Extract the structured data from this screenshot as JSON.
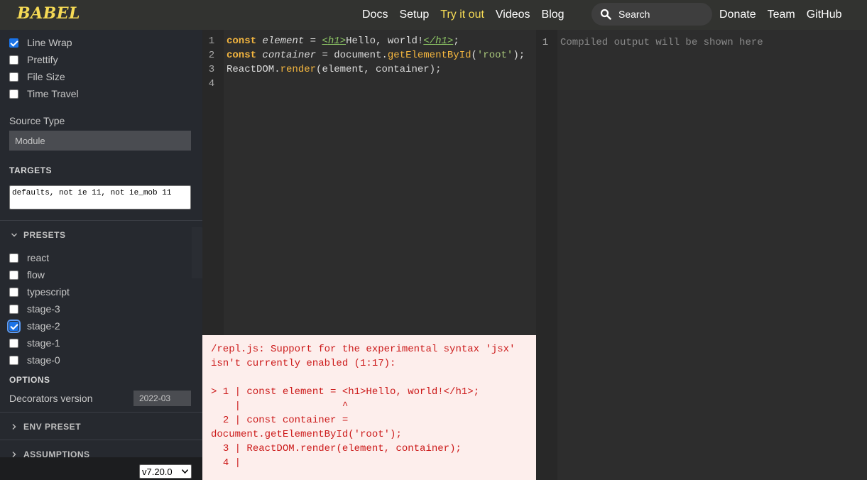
{
  "header": {
    "logo": "BABEL",
    "nav": [
      "Docs",
      "Setup",
      "Try it out",
      "Videos",
      "Blog"
    ],
    "nav_right": [
      "Donate",
      "Team",
      "GitHub"
    ],
    "search_placeholder": "Search",
    "accent": "#f5da55"
  },
  "sidebar": {
    "checkboxes": [
      {
        "label": "Line Wrap",
        "checked": true
      },
      {
        "label": "Prettify",
        "checked": false
      },
      {
        "label": "File Size",
        "checked": false
      },
      {
        "label": "Time Travel",
        "checked": false
      }
    ],
    "source_type_label": "Source Type",
    "source_type_value": "Module",
    "targets_label": "TARGETS",
    "targets_value": "defaults, not ie 11, not ie_mob 11",
    "presets_label": "PRESETS",
    "presets": [
      {
        "label": "react",
        "checked": false
      },
      {
        "label": "flow",
        "checked": false
      },
      {
        "label": "typescript",
        "checked": false
      },
      {
        "label": "stage-3",
        "checked": false
      },
      {
        "label": "stage-2",
        "checked": true
      },
      {
        "label": "stage-1",
        "checked": false
      },
      {
        "label": "stage-0",
        "checked": false
      }
    ],
    "options_label": "OPTIONS",
    "decorators_label": "Decorators version",
    "decorators_value": "2022-03",
    "env_preset_label": "ENV PRESET",
    "assumptions_label": "ASSUMPTIONS",
    "version": "v7.20.0"
  },
  "editor": {
    "line_numbers": [
      "1",
      "2",
      "3",
      "4"
    ]
  },
  "error": {
    "message": "/repl.js: Support for the experimental syntax 'jsx' isn't currently enabled (1:17):\n\n> 1 | const element = <h1>Hello, world!</h1>;\n    |                 ^\n  2 | const container =\ndocument.getElementById('root');\n  3 | ReactDOM.render(element, container);\n  4 |"
  },
  "output": {
    "line_number": "1",
    "placeholder": "Compiled output will be shown here"
  }
}
